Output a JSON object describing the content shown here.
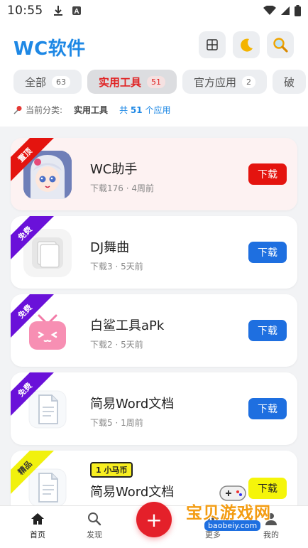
{
  "status_bar": {
    "time": "10:55",
    "icons": [
      "download-icon",
      "a-box-icon",
      "wifi-icon",
      "signal-icon",
      "battery-icon"
    ]
  },
  "header": {
    "title": "WC软件",
    "buttons": [
      "grid-icon",
      "moon-icon",
      "search-icon"
    ]
  },
  "tabs": [
    {
      "label": "全部",
      "count": "63",
      "active": false
    },
    {
      "label": "实用工具",
      "count": "51",
      "active": true
    },
    {
      "label": "官方应用",
      "count": "2",
      "active": false
    },
    {
      "label": "破",
      "count": "",
      "active": false
    }
  ],
  "category": {
    "prefix": "当前分类:",
    "name": "实用工具",
    "total_prefix": "共",
    "total_count": "51",
    "total_suffix": "个应用"
  },
  "apps": [
    {
      "name": "WC助手",
      "downloads": "下载176",
      "time": "4周前",
      "ribbon": "置顶",
      "ribbon_color": "#e4140f",
      "button": "下载",
      "button_color": "#e4140f",
      "icon": "anime-girl-icon",
      "badge": ""
    },
    {
      "name": "DJ舞曲",
      "downloads": "下载3",
      "time": "5天前",
      "ribbon": "免费",
      "ribbon_color": "#6a11d9",
      "button": "下载",
      "button_color": "#1e6fe0",
      "icon": "stack-square-icon",
      "badge": ""
    },
    {
      "name": "白鲨工具aPk",
      "downloads": "下载2",
      "time": "5天前",
      "ribbon": "免费",
      "ribbon_color": "#6a11d9",
      "button": "下载",
      "button_color": "#1e6fe0",
      "icon": "pink-tv-icon",
      "badge": ""
    },
    {
      "name": "简易Word文档",
      "downloads": "下载5",
      "time": "1周前",
      "ribbon": "免费",
      "ribbon_color": "#6a11d9",
      "button": "下载",
      "button_color": "#1e6fe0",
      "icon": "document-icon",
      "badge": ""
    },
    {
      "name": "简易Word文档",
      "downloads": "",
      "time": "",
      "ribbon": "精品",
      "ribbon_color": "#f1f10d",
      "button": "下载",
      "button_color": "#f5f50a",
      "icon": "document-icon",
      "badge": "1 小马币"
    }
  ],
  "bottom_nav": [
    {
      "label": "首页",
      "icon": "home-icon"
    },
    {
      "label": "发现",
      "icon": "search-icon"
    },
    {
      "label": "更多",
      "icon": "more-icon"
    },
    {
      "label": "我的",
      "icon": "user-icon"
    }
  ],
  "fab": {
    "label": "+"
  },
  "watermark": {
    "title": "宝贝游戏网",
    "url": "baobeiy.com"
  }
}
